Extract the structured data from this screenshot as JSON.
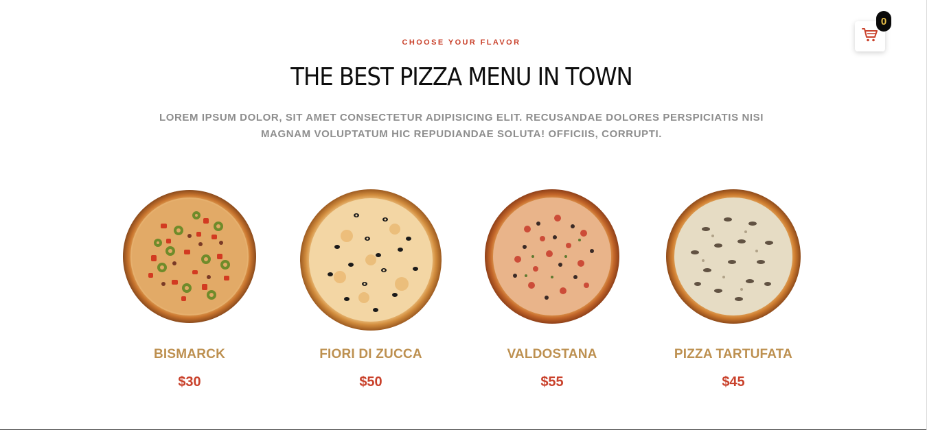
{
  "header": {
    "eyebrow": "CHOOSE YOUR FLAVOR",
    "title": "THE BEST PIZZA MENU IN TOWN",
    "description": "LOREM IPSUM DOLOR, SIT AMET CONSECTETUR ADIPISICING ELIT. RECUSANDAE DOLORES PERSPICIATIS NISI MAGNAM VOLUPTATUM HIC REPUDIANDAE SOLUTA! OFFICIIS, CORRUPTI."
  },
  "cart": {
    "count": "0",
    "icon": "shopping-cart-icon"
  },
  "menu": {
    "items": [
      {
        "name": "BISMARCK",
        "price": "$30"
      },
      {
        "name": "FIORI DI ZUCCA",
        "price": "$50"
      },
      {
        "name": "VALDOSTANA",
        "price": "$55"
      },
      {
        "name": "PIZZA TARTUFATA",
        "price": "$45"
      }
    ]
  },
  "colors": {
    "accent_red": "#c9412b",
    "gold": "#bd9050",
    "muted_text": "#8d8d8d",
    "badge_bg": "#0a0a0a",
    "badge_text": "#e9c04a"
  }
}
